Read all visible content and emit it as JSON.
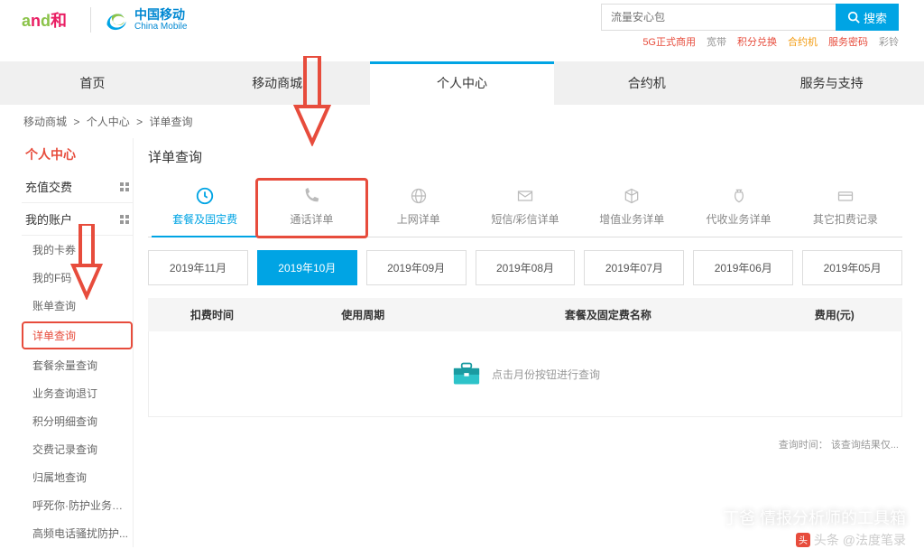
{
  "header": {
    "brand_cn": "中国移动",
    "brand_en": "China Mobile",
    "search_placeholder": "流量安心包",
    "search_btn": "搜索",
    "hot_links": [
      "5G正式商用",
      "宽带",
      "积分兑换",
      "合约机",
      "服务密码",
      "彩铃"
    ]
  },
  "nav": {
    "items": [
      "首页",
      "移动商城",
      "个人中心",
      "合约机",
      "服务与支持"
    ],
    "active_index": 2
  },
  "crumb": [
    "移动商城",
    "个人中心",
    "详单查询"
  ],
  "sidebar": {
    "title": "个人中心",
    "groups": [
      {
        "label": "充值交费"
      },
      {
        "label": "我的账户"
      }
    ],
    "subs": [
      "我的卡券",
      "我的F码",
      "账单查询",
      "详单查询",
      "套餐余量查询",
      "业务查询退订",
      "积分明细查询",
      "交费记录查询",
      "归属地查询",
      "呼死你·防护业务设置",
      "高频电话骚扰防护..."
    ],
    "highlight_index": 3
  },
  "content": {
    "title": "详单查询",
    "tabs": [
      "套餐及固定费",
      "通话详单",
      "上网详单",
      "短信/彩信详单",
      "增值业务详单",
      "代收业务详单",
      "其它扣费记录"
    ],
    "active_tab_index": 0,
    "highlight_tab_index": 1,
    "months": [
      "2019年11月",
      "2019年10月",
      "2019年09月",
      "2019年08月",
      "2019年07月",
      "2019年06月",
      "2019年05月"
    ],
    "active_month_index": 1,
    "table_headers": [
      "扣费时间",
      "使用周期",
      "套餐及固定费名称",
      "费用(元)"
    ],
    "empty_hint": "点击月份按钮进行查询",
    "footer": "查询时间： 该查询结果仅..."
  },
  "watermark": {
    "line1": "丁爸 情报分析师的工具箱",
    "line2": "头条 @法度笔录"
  }
}
